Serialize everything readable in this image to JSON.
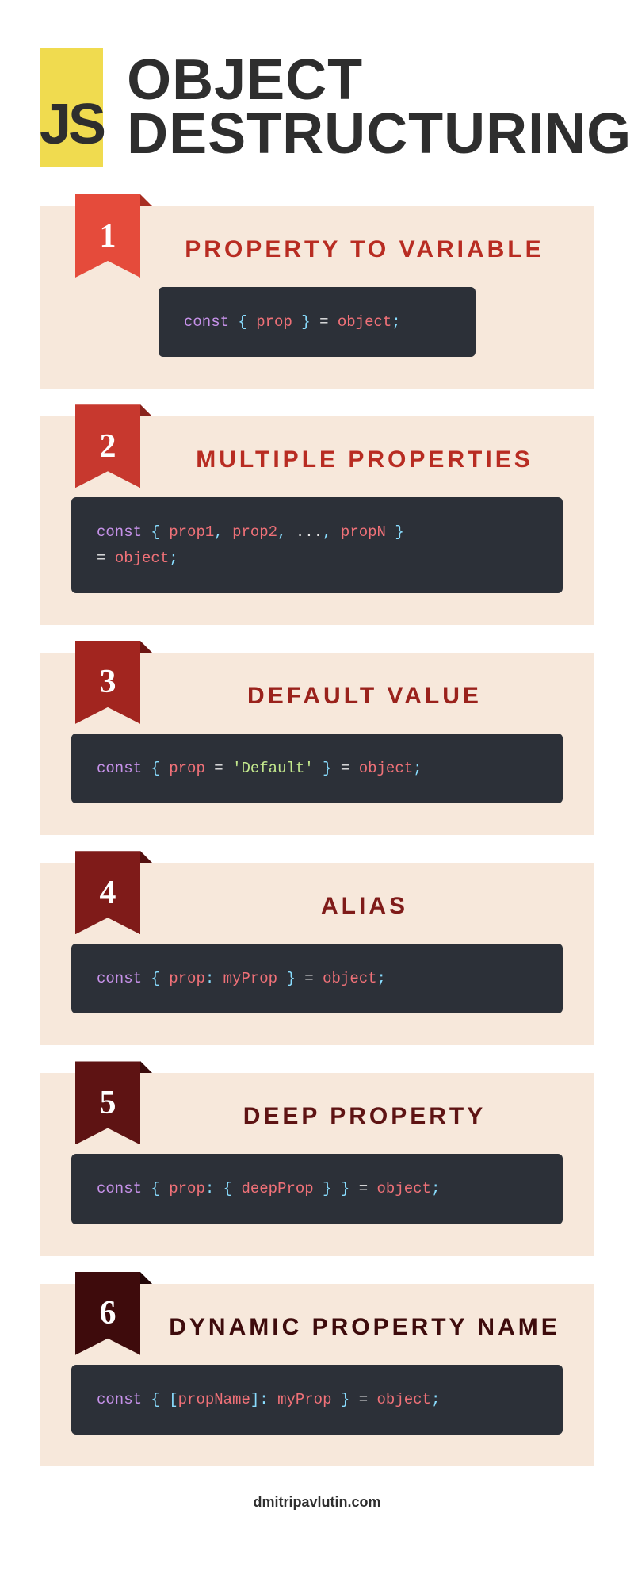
{
  "header": {
    "logo_text": "JS",
    "title_line1": "OBJECT",
    "title_line2": "DESTRUCTURING"
  },
  "sections": [
    {
      "num": "1",
      "title": "PROPERTY TO VARIABLE",
      "ribbon_bg": "#e54b3b",
      "ribbon_fold": "#a82e22",
      "title_color": "#b82c22",
      "code_width": "narrow",
      "code_tokens": [
        {
          "t": "kw",
          "v": "const"
        },
        {
          "t": "plain",
          "v": " "
        },
        {
          "t": "punc",
          "v": "{"
        },
        {
          "t": "plain",
          "v": " "
        },
        {
          "t": "ident",
          "v": "prop"
        },
        {
          "t": "plain",
          "v": " "
        },
        {
          "t": "punc",
          "v": "}"
        },
        {
          "t": "plain",
          "v": " "
        },
        {
          "t": "op",
          "v": "="
        },
        {
          "t": "plain",
          "v": " "
        },
        {
          "t": "ident",
          "v": "object"
        },
        {
          "t": "punc",
          "v": ";"
        }
      ]
    },
    {
      "num": "2",
      "title": "MULTIPLE PROPERTIES",
      "ribbon_bg": "#c7382e",
      "ribbon_fold": "#8a231c",
      "title_color": "#b82c22",
      "code_width": "wide",
      "code_tokens": [
        {
          "t": "kw",
          "v": "const"
        },
        {
          "t": "plain",
          "v": " "
        },
        {
          "t": "punc",
          "v": "{"
        },
        {
          "t": "plain",
          "v": " "
        },
        {
          "t": "ident",
          "v": "prop1"
        },
        {
          "t": "punc",
          "v": ","
        },
        {
          "t": "plain",
          "v": " "
        },
        {
          "t": "ident",
          "v": "prop2"
        },
        {
          "t": "punc",
          "v": ","
        },
        {
          "t": "plain",
          "v": " "
        },
        {
          "t": "op",
          "v": "..."
        },
        {
          "t": "punc",
          "v": ","
        },
        {
          "t": "plain",
          "v": " "
        },
        {
          "t": "ident",
          "v": "propN"
        },
        {
          "t": "plain",
          "v": " "
        },
        {
          "t": "punc",
          "v": "}"
        },
        {
          "t": "br"
        },
        {
          "t": "plain",
          "v": "    "
        },
        {
          "t": "op",
          "v": "="
        },
        {
          "t": "plain",
          "v": " "
        },
        {
          "t": "ident",
          "v": "object"
        },
        {
          "t": "punc",
          "v": ";"
        }
      ]
    },
    {
      "num": "3",
      "title": "DEFAULT VALUE",
      "ribbon_bg": "#a2251f",
      "ribbon_fold": "#6d1613",
      "title_color": "#9a221c",
      "code_width": "wide",
      "code_tokens": [
        {
          "t": "kw",
          "v": "const"
        },
        {
          "t": "plain",
          "v": " "
        },
        {
          "t": "punc",
          "v": "{"
        },
        {
          "t": "plain",
          "v": " "
        },
        {
          "t": "ident",
          "v": "prop"
        },
        {
          "t": "plain",
          "v": " "
        },
        {
          "t": "op",
          "v": "="
        },
        {
          "t": "plain",
          "v": " "
        },
        {
          "t": "str",
          "v": "'Default'"
        },
        {
          "t": "plain",
          "v": " "
        },
        {
          "t": "punc",
          "v": "}"
        },
        {
          "t": "plain",
          "v": " "
        },
        {
          "t": "op",
          "v": "="
        },
        {
          "t": "plain",
          "v": " "
        },
        {
          "t": "ident",
          "v": "object"
        },
        {
          "t": "punc",
          "v": ";"
        }
      ]
    },
    {
      "num": "4",
      "title": "ALIAS",
      "ribbon_bg": "#7f1b19",
      "ribbon_fold": "#53100f",
      "title_color": "#7f1b19",
      "code_width": "wide",
      "code_tokens": [
        {
          "t": "kw",
          "v": "const"
        },
        {
          "t": "plain",
          "v": " "
        },
        {
          "t": "punc",
          "v": "{"
        },
        {
          "t": "plain",
          "v": " "
        },
        {
          "t": "ident",
          "v": "prop"
        },
        {
          "t": "punc",
          "v": ":"
        },
        {
          "t": "plain",
          "v": " "
        },
        {
          "t": "ident",
          "v": "myProp"
        },
        {
          "t": "plain",
          "v": " "
        },
        {
          "t": "punc",
          "v": "}"
        },
        {
          "t": "plain",
          "v": " "
        },
        {
          "t": "op",
          "v": "="
        },
        {
          "t": "plain",
          "v": " "
        },
        {
          "t": "ident",
          "v": "object"
        },
        {
          "t": "punc",
          "v": ";"
        }
      ]
    },
    {
      "num": "5",
      "title": "DEEP PROPERTY",
      "ribbon_bg": "#5e1313",
      "ribbon_fold": "#3a0b0b",
      "title_color": "#5e1313",
      "code_width": "wide",
      "code_tokens": [
        {
          "t": "kw",
          "v": "const"
        },
        {
          "t": "plain",
          "v": " "
        },
        {
          "t": "punc",
          "v": "{"
        },
        {
          "t": "plain",
          "v": " "
        },
        {
          "t": "ident",
          "v": "prop"
        },
        {
          "t": "punc",
          "v": ":"
        },
        {
          "t": "plain",
          "v": " "
        },
        {
          "t": "punc",
          "v": "{"
        },
        {
          "t": "plain",
          "v": " "
        },
        {
          "t": "ident",
          "v": "deepProp"
        },
        {
          "t": "plain",
          "v": " "
        },
        {
          "t": "punc",
          "v": "}"
        },
        {
          "t": "plain",
          "v": " "
        },
        {
          "t": "punc",
          "v": "}"
        },
        {
          "t": "plain",
          "v": " "
        },
        {
          "t": "op",
          "v": "="
        },
        {
          "t": "plain",
          "v": " "
        },
        {
          "t": "ident",
          "v": "object"
        },
        {
          "t": "punc",
          "v": ";"
        }
      ]
    },
    {
      "num": "6",
      "title": "DYNAMIC PROPERTY NAME",
      "ribbon_bg": "#3e0b0c",
      "ribbon_fold": "#220606",
      "title_color": "#3e0b0c",
      "code_width": "wide",
      "code_tokens": [
        {
          "t": "kw",
          "v": "const"
        },
        {
          "t": "plain",
          "v": " "
        },
        {
          "t": "punc",
          "v": "{"
        },
        {
          "t": "plain",
          "v": " "
        },
        {
          "t": "punc",
          "v": "["
        },
        {
          "t": "ident",
          "v": "propName"
        },
        {
          "t": "punc",
          "v": "]"
        },
        {
          "t": "punc",
          "v": ":"
        },
        {
          "t": "plain",
          "v": " "
        },
        {
          "t": "ident",
          "v": "myProp"
        },
        {
          "t": "plain",
          "v": " "
        },
        {
          "t": "punc",
          "v": "}"
        },
        {
          "t": "plain",
          "v": " "
        },
        {
          "t": "op",
          "v": "="
        },
        {
          "t": "plain",
          "v": " "
        },
        {
          "t": "ident",
          "v": "object"
        },
        {
          "t": "punc",
          "v": ";"
        }
      ]
    }
  ],
  "footer": {
    "text": "dmitripavlutin.com"
  }
}
